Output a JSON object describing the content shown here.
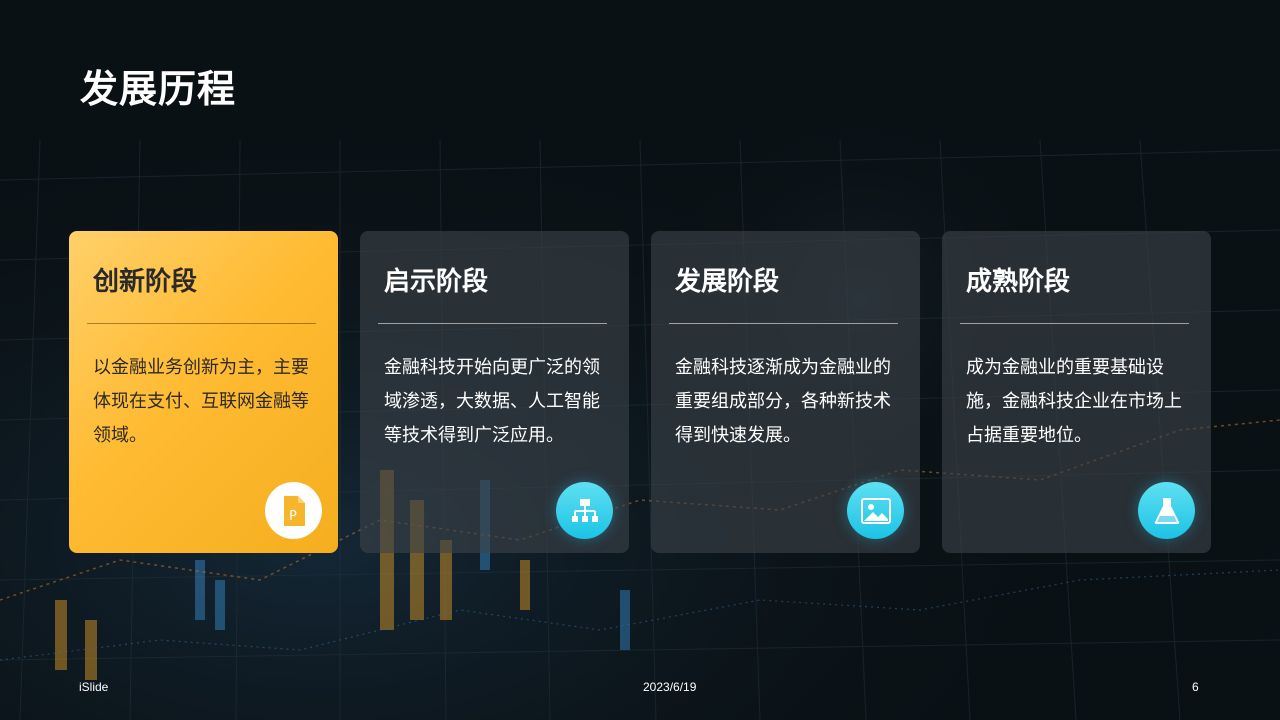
{
  "slide": {
    "title": "发展历程",
    "cards": [
      {
        "title": "创新阶段",
        "text": "以金融业务创新为主，主要体现在支付、互联网金融等领域。",
        "icon": "document-icon",
        "highlighted": true
      },
      {
        "title": "启示阶段",
        "text": "金融科技开始向更广泛的领域渗透，大数据、人工智能等技术得到广泛应用。",
        "icon": "org-chart-icon",
        "highlighted": false
      },
      {
        "title": "发展阶段",
        "text": "金融科技逐渐成为金融业的重要组成部分，各种新技术得到快速发展。",
        "icon": "image-icon",
        "highlighted": false
      },
      {
        "title": "成熟阶段",
        "text": "成为金融业的重要基础设施，金融科技企业在市场上占据重要地位。",
        "icon": "flask-icon",
        "highlighted": false
      }
    ]
  },
  "footer": {
    "brand": "iSlide",
    "date": "2023/6/19",
    "page_number": "6"
  },
  "colors": {
    "accent": "#ffbb33",
    "icon_cyan": "#1cc3e6",
    "background": "#0a1115"
  }
}
